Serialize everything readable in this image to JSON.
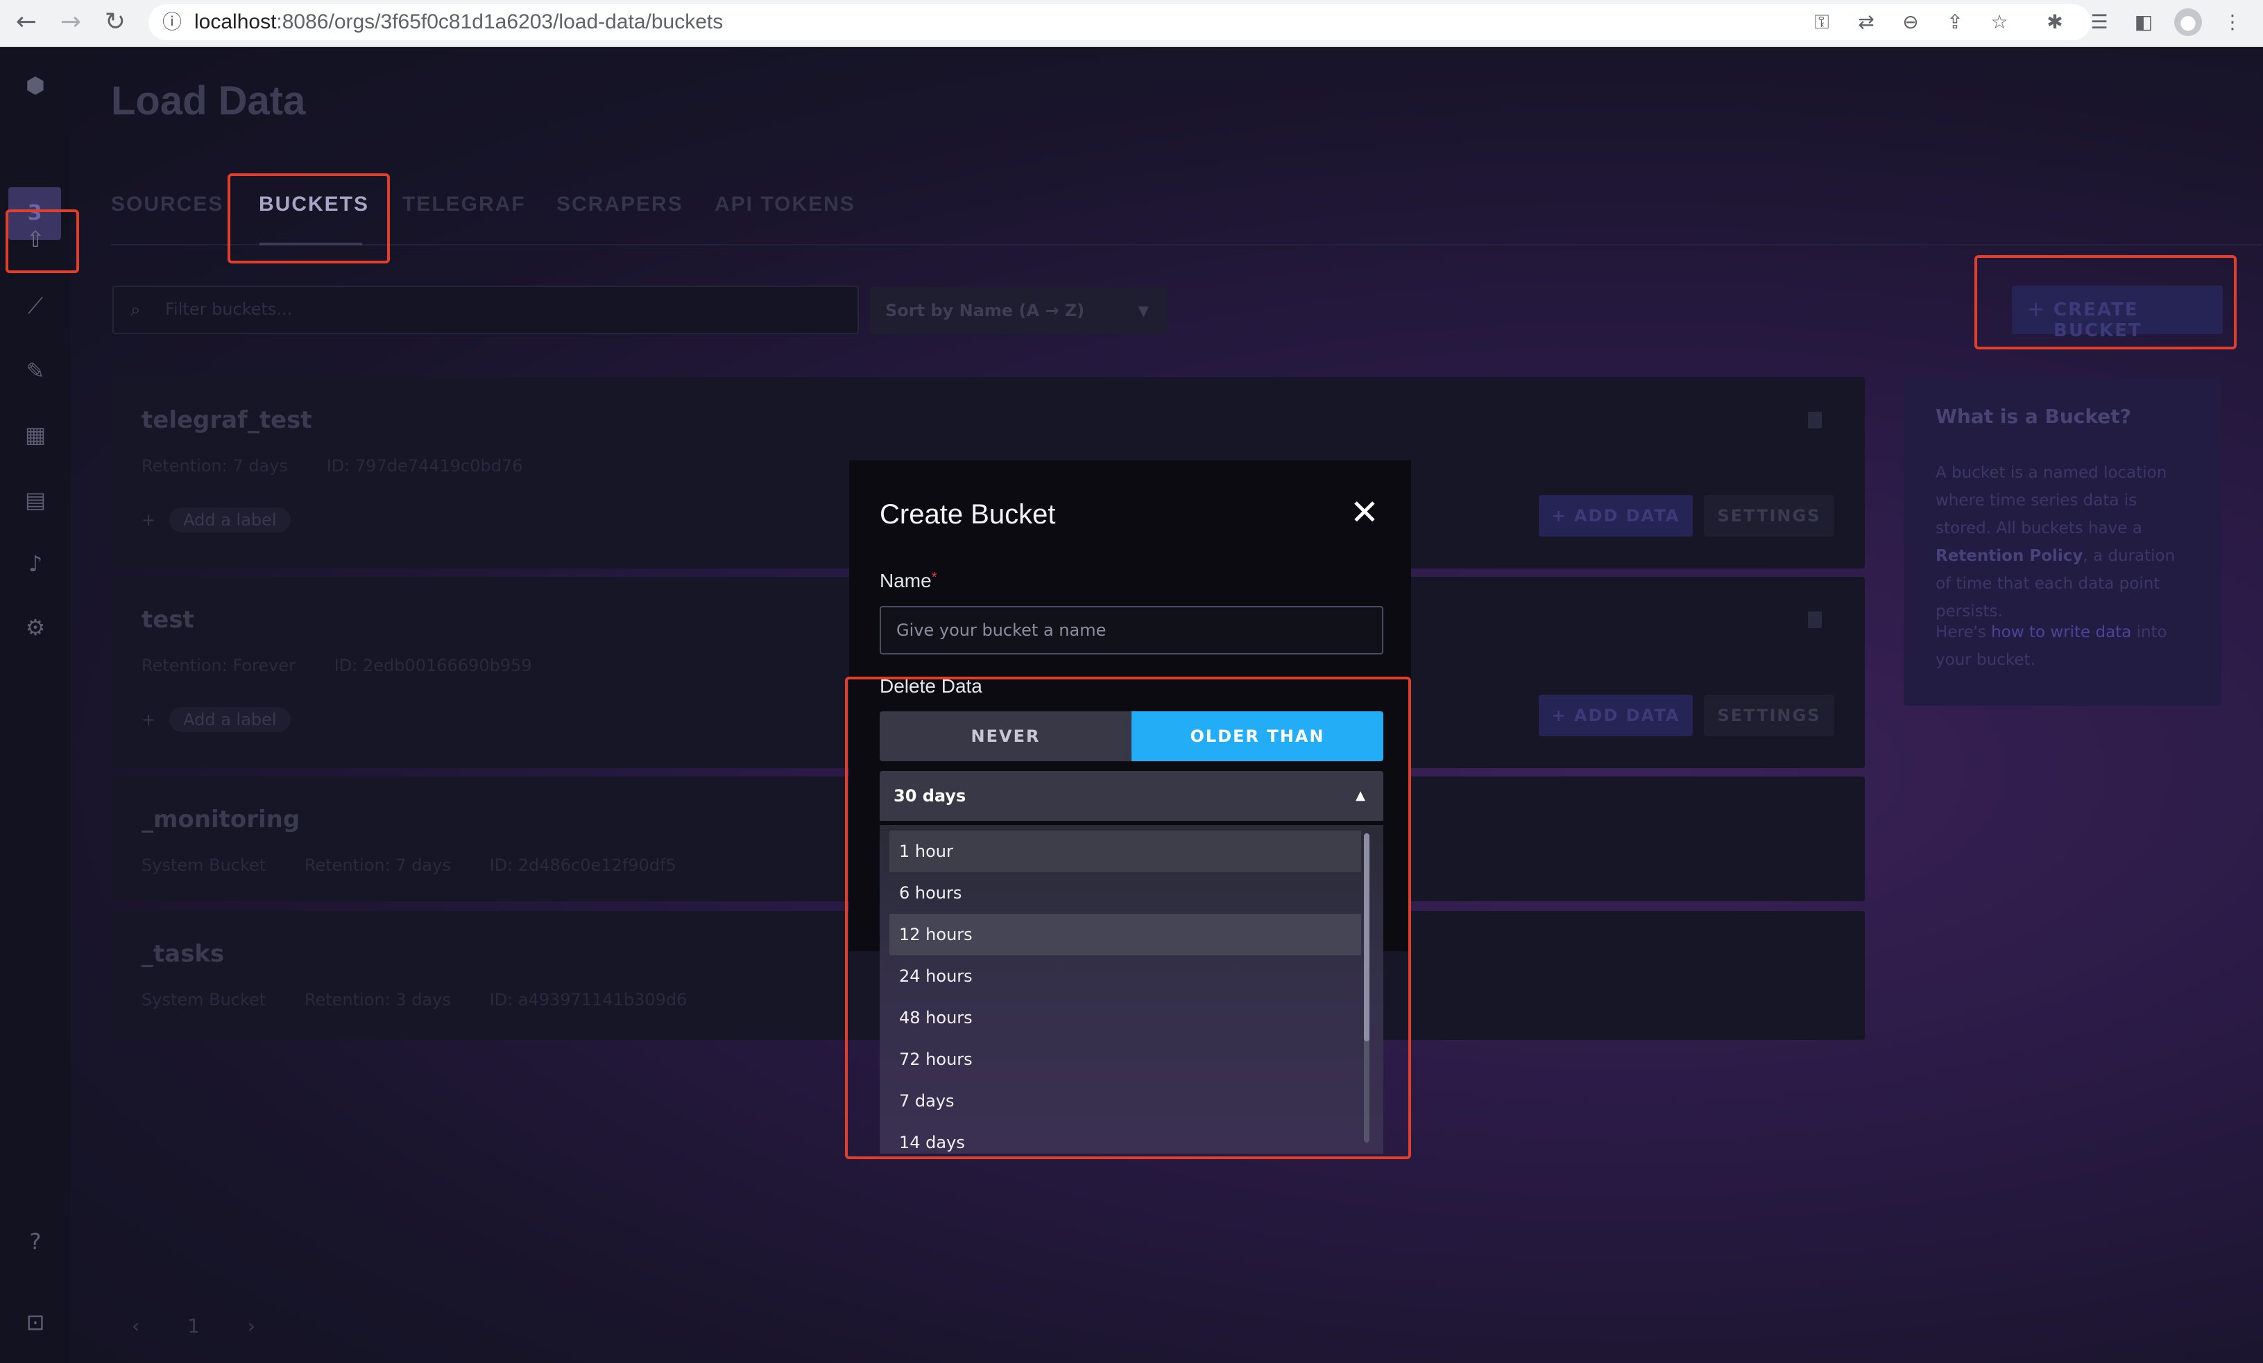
{
  "browser": {
    "url_host": "localhost",
    "url_path": ":8086/orgs/3f65f0c81d1a6203/load-data/buckets"
  },
  "sidebar": {
    "org_badge": "3"
  },
  "page": {
    "title": "Load Data",
    "tabs": [
      {
        "label": "SOURCES"
      },
      {
        "label": "BUCKETS"
      },
      {
        "label": "TELEGRAF"
      },
      {
        "label": "SCRAPERS"
      },
      {
        "label": "API TOKENS"
      }
    ],
    "filter_placeholder": "Filter buckets...",
    "sort_label": "Sort by Name (A → Z)",
    "create_button": "CREATE BUCKET",
    "pager_page": "1"
  },
  "buckets": [
    {
      "name": "telegraf_test",
      "meta": [
        "Retention: 7 days",
        "ID: 797de74419c0bd76"
      ],
      "label_add": "Add a label",
      "add_data": "ADD DATA",
      "settings": "SETTINGS"
    },
    {
      "name": "test",
      "meta": [
        "Retention: Forever",
        "ID: 2edb00166690b959"
      ],
      "label_add": "Add a label",
      "add_data": "ADD DATA",
      "settings": "SETTINGS"
    },
    {
      "name": "_monitoring",
      "meta": [
        "System Bucket",
        "Retention: 7 days",
        "ID: 2d486c0e12f90df5"
      ]
    },
    {
      "name": "_tasks",
      "meta": [
        "System Bucket",
        "Retention: 3 days",
        "ID: a493971141b309d6"
      ]
    }
  ],
  "info": {
    "title": "What is a Bucket?",
    "p1_a": "A bucket is a named location where time series data is stored. All buckets have a ",
    "p1_b": "Retention Policy",
    "p1_c": ", a duration of time that each data point persists.",
    "p2_a": "Here's ",
    "p2_link": "how to write data",
    "p2_b": " into your bucket."
  },
  "modal": {
    "title": "Create Bucket",
    "name_label": "Name",
    "name_required": "*",
    "name_placeholder": "Give your bucket a name",
    "delete_label": "Delete Data",
    "never": "NEVER",
    "older_than": "OLDER THAN",
    "selected": "30 days",
    "options": [
      "1 hour",
      "6 hours",
      "12 hours",
      "24 hours",
      "48 hours",
      "72 hours",
      "7 days",
      "14 days"
    ]
  },
  "colors": {
    "accent": "#22adf6",
    "highlight": "#e0402b"
  }
}
